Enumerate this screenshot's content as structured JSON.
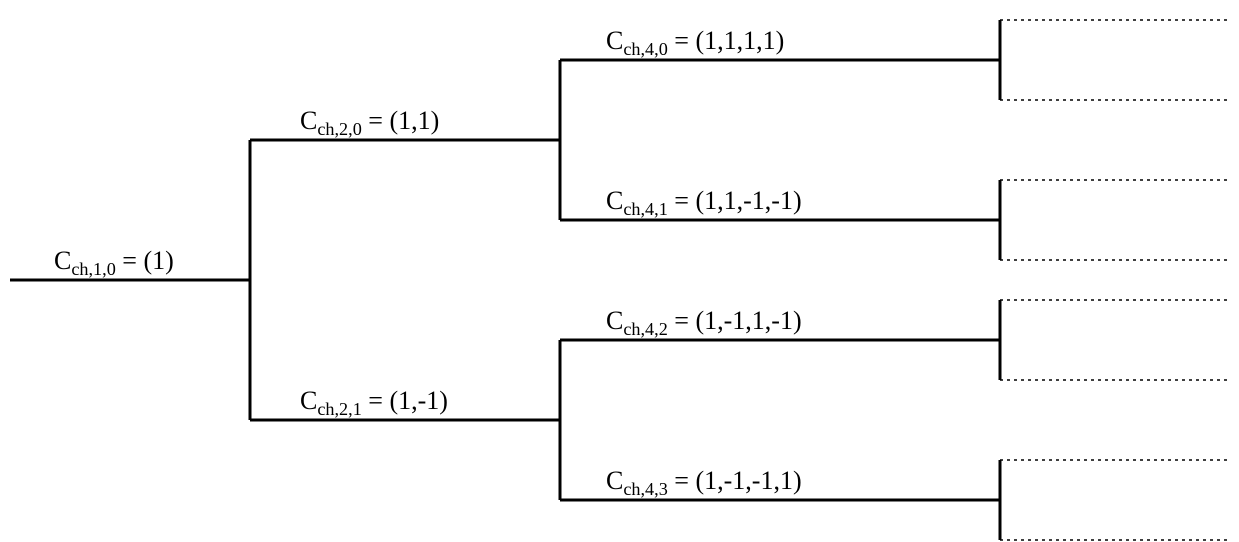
{
  "tree": {
    "root": {
      "name": "C",
      "sub": "ch,1,0",
      "value": "(1)"
    },
    "level2": [
      {
        "name": "C",
        "sub": "ch,2,0",
        "value": "(1,1)"
      },
      {
        "name": "C",
        "sub": "ch,2,1",
        "value": "(1,-1)"
      }
    ],
    "level3": [
      {
        "name": "C",
        "sub": "ch,4,0",
        "value": "(1,1,1,1)"
      },
      {
        "name": "C",
        "sub": "ch,4,1",
        "value": "(1,1,-1,-1)"
      },
      {
        "name": "C",
        "sub": "ch,4,2",
        "value": "(1,-1,1,-1)"
      },
      {
        "name": "C",
        "sub": "ch,4,3",
        "value": "(1,-1,-1,1)"
      }
    ]
  }
}
